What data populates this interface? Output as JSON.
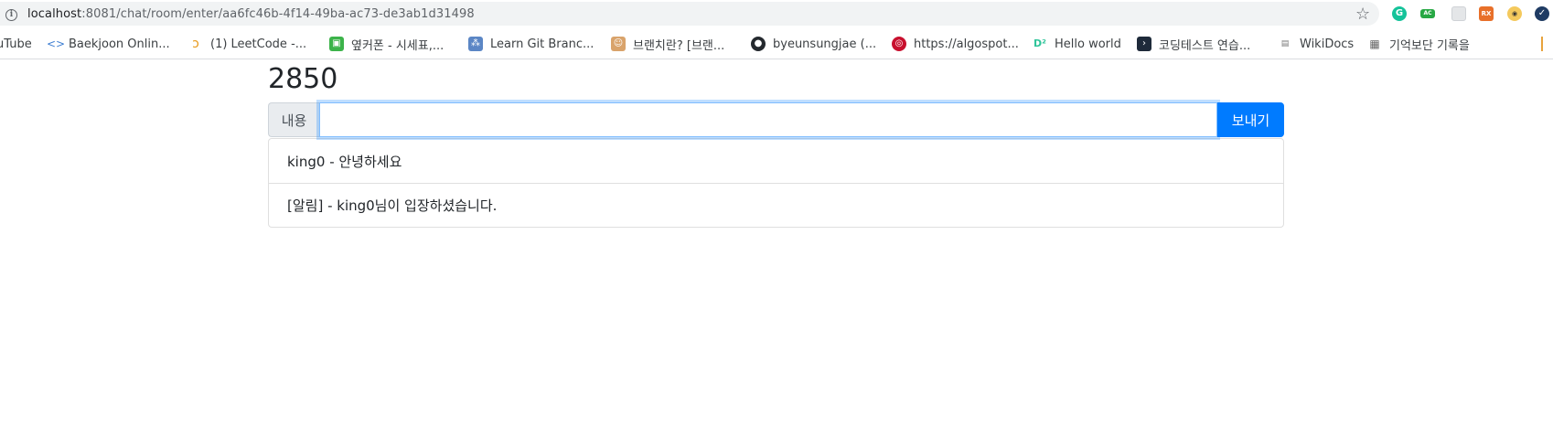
{
  "browser": {
    "url_host": "localhost",
    "url_path": ":8081/chat/room/enter/aa6fc46b-4f14-49ba-ac73-de3ab1d31498",
    "extension_icons": [
      "grammarly-icon",
      "ac-icon",
      "grid-icon",
      "rx-icon",
      "owl-icon",
      "check-icon"
    ]
  },
  "bookmarks": [
    {
      "label": "uTube",
      "icon": "youtube-icon"
    },
    {
      "label": "Baekjoon Onlin...",
      "icon": "code-bracket-icon"
    },
    {
      "label": "(1) LeetCode -...",
      "icon": "leetcode-icon"
    },
    {
      "label": "옆커폰 - 시세표,...",
      "icon": "phone-icon"
    },
    {
      "label": "Learn Git Branc...",
      "icon": "git-icon"
    },
    {
      "label": "브랜치란? [브랜...",
      "icon": "mascot-icon"
    },
    {
      "label": "byeunsungjae (...",
      "icon": "github-icon"
    },
    {
      "label": "https://algospot...",
      "icon": "target-icon"
    },
    {
      "label": "Hello world",
      "icon": "d2-icon"
    },
    {
      "label": "코딩테스트 연습...",
      "icon": "programmers-icon"
    },
    {
      "label": "WikiDocs",
      "icon": "wikidocs-icon"
    },
    {
      "label": "기억보단 기록을",
      "icon": "blog-icon"
    }
  ],
  "room": {
    "title": "2850"
  },
  "composer": {
    "prefix_label": "내용",
    "input_value": "",
    "send_label": "보내기"
  },
  "messages": [
    {
      "text": "king0 - 안녕하세요"
    },
    {
      "text": "[알림] - king0님이 입장하셨습니다."
    }
  ],
  "colors": {
    "primary": "#007bff",
    "input_focus_border": "#80bdff",
    "prepend_bg": "#e9ecef"
  }
}
